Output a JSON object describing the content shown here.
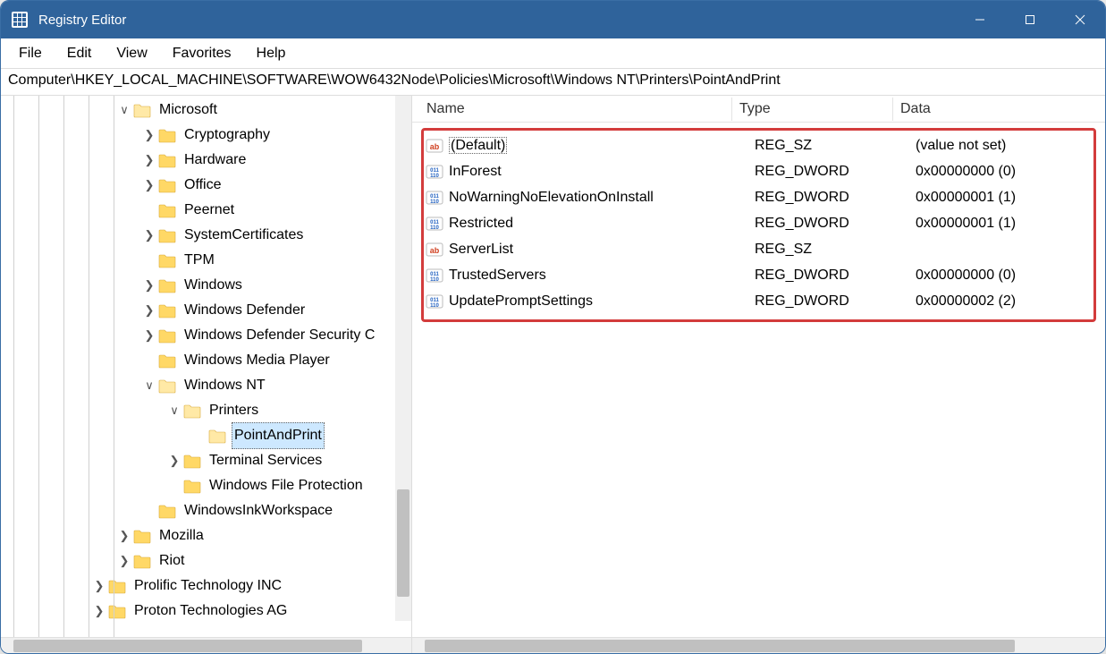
{
  "window": {
    "title": "Registry Editor"
  },
  "menu": {
    "file": "File",
    "edit": "Edit",
    "view": "View",
    "favorites": "Favorites",
    "help": "Help"
  },
  "address": "Computer\\HKEY_LOCAL_MACHINE\\SOFTWARE\\WOW6432Node\\Policies\\Microsoft\\Windows NT\\Printers\\PointAndPrint",
  "tree": {
    "microsoft": "Microsoft",
    "cryptography": "Cryptography",
    "hardware": "Hardware",
    "office": "Office",
    "peernet": "Peernet",
    "syscert": "SystemCertificates",
    "tpm": "TPM",
    "windows": "Windows",
    "windef": "Windows Defender",
    "windefsec": "Windows Defender Security C",
    "wmp": "Windows Media Player",
    "winnt": "Windows NT",
    "printers": "Printers",
    "pap": "PointAndPrint",
    "termserv": "Terminal Services",
    "wfp": "Windows File Protection",
    "winkws": "WindowsInkWorkspace",
    "mozilla": "Mozilla",
    "riot": "Riot",
    "prolific": "Prolific Technology INC",
    "proton": "Proton Technologies AG"
  },
  "columns": {
    "name": "Name",
    "type": "Type",
    "data": "Data"
  },
  "values": [
    {
      "name": "(Default)",
      "type": "REG_SZ",
      "data": "(value not set)",
      "icon": "sz",
      "default": true
    },
    {
      "name": "InForest",
      "type": "REG_DWORD",
      "data": "0x00000000 (0)",
      "icon": "dw"
    },
    {
      "name": "NoWarningNoElevationOnInstall",
      "type": "REG_DWORD",
      "data": "0x00000001 (1)",
      "icon": "dw"
    },
    {
      "name": "Restricted",
      "type": "REG_DWORD",
      "data": "0x00000001 (1)",
      "icon": "dw"
    },
    {
      "name": "ServerList",
      "type": "REG_SZ",
      "data": "",
      "icon": "sz"
    },
    {
      "name": "TrustedServers",
      "type": "REG_DWORD",
      "data": "0x00000000 (0)",
      "icon": "dw"
    },
    {
      "name": "UpdatePromptSettings",
      "type": "REG_DWORD",
      "data": "0x00000002 (2)",
      "icon": "dw"
    }
  ]
}
